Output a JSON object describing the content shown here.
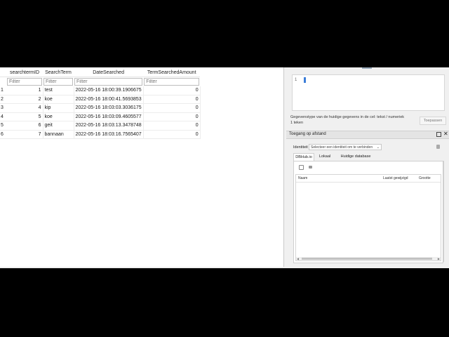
{
  "grid": {
    "columns": [
      "searchtermID",
      "SearchTerm",
      "DateSearched",
      "TermSearchedAmount"
    ],
    "filter_placeholder": "Filter",
    "rows": [
      {
        "rownum": "1",
        "id": "1",
        "term": "test",
        "date": "2022-05-16 18:00:39.1906675",
        "amount": "0"
      },
      {
        "rownum": "2",
        "id": "2",
        "term": "koe",
        "date": "2022-05-16 18:00:41.5693853",
        "amount": "0"
      },
      {
        "rownum": "3",
        "id": "4",
        "term": "kip",
        "date": "2022-05-16 18:03:03.3036175",
        "amount": "0"
      },
      {
        "rownum": "4",
        "id": "5",
        "term": "koe",
        "date": "2022-05-16 18:03:09.4605577",
        "amount": "0"
      },
      {
        "rownum": "5",
        "id": "6",
        "term": "geit",
        "date": "2022-05-16 18:03:13.3478748",
        "amount": "0"
      },
      {
        "rownum": "6",
        "id": "7",
        "term": "bannaan",
        "date": "2022-05-16 18:03:16.7565407",
        "amount": "0"
      }
    ]
  },
  "edit_cell": {
    "line_number": "1",
    "type_info": "Gegevenstype van de huidige gegevens in de cel: tekst / numeriek",
    "size_info": "1 teken",
    "apply_label": "Toepassen"
  },
  "remote": {
    "title": "Toegang op afstand",
    "identity_label": "Identiteit",
    "identity_value": "Selecteer een identiteit om te verbinden",
    "tabs": [
      "DBHub.io",
      "Lokaal",
      "Huidige database"
    ],
    "columns": [
      "Naam",
      "Laatst gewijzigd",
      "Grootte"
    ]
  },
  "icons": {
    "float": "float-window-icon",
    "close": "close-icon",
    "identity": "identity-icon",
    "refresh": "refresh-icon",
    "clone": "clone-icon"
  }
}
